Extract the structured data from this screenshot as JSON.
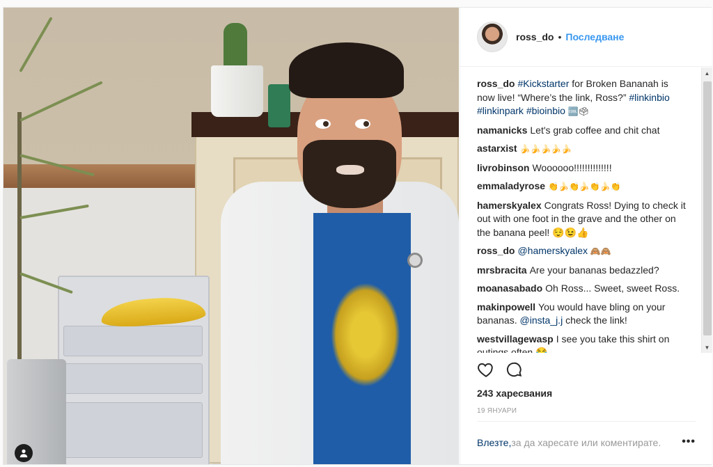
{
  "post": {
    "username": "ross_do",
    "separator": "•",
    "follow_label": "Последване",
    "likes_text": "243 харесвания",
    "date_text": "19 ЯНУАРИ",
    "login_link": "Влезте,",
    "login_rest": " за да харесате или коментирате.",
    "more_label": "•••"
  },
  "caption": {
    "username": "ross_do",
    "tag1": "#Kickstarter",
    "text1": " for Broken Bananah is now live! “Where’s the link, Ross?” ",
    "tag2": "#linkinbio",
    "tag3": "#linkinpark",
    "tag4": "#bioinbio",
    "emoji": "🆒🗳"
  },
  "comments": [
    {
      "user": "namanicks",
      "text": "Let's grab coffee and chit chat"
    },
    {
      "user": "astarxist",
      "text": "🍌🍌🍌🍌🍌"
    },
    {
      "user": "livrobinson",
      "text": "Woooooo!!!!!!!!!!!!!!"
    },
    {
      "user": "emmaladyrose",
      "text": "👏🍌👏🍌👏🍌👏"
    },
    {
      "user": "hamerskyalex",
      "text": "Congrats Ross! Dying to check it out with one foot in the grave and the other on the banana peel! 😌😉👍"
    },
    {
      "user": "ross_do",
      "mention": "@hamerskyalex",
      "text": " 🙈🙈"
    },
    {
      "user": "mrsbracita",
      "text": "Are your bananas bedazzled?"
    },
    {
      "user": "moanasabado",
      "text": "Oh Ross... Sweet, sweet Ross."
    },
    {
      "user": "makinpowell",
      "text": "You would have bling on your bananas. ",
      "mention": "@insta_j.j",
      "text_after": " check the link!"
    },
    {
      "user": "westvillagewasp",
      "text": "I see you take this shirt on outings often 😂"
    }
  ],
  "icons": {
    "like": "heart-outline-icon",
    "comment": "speech-bubble-icon",
    "tagged_user": "person-icon"
  },
  "colors": {
    "link": "#003569",
    "follow": "#3897f0",
    "text": "#262626",
    "muted": "#999999"
  }
}
